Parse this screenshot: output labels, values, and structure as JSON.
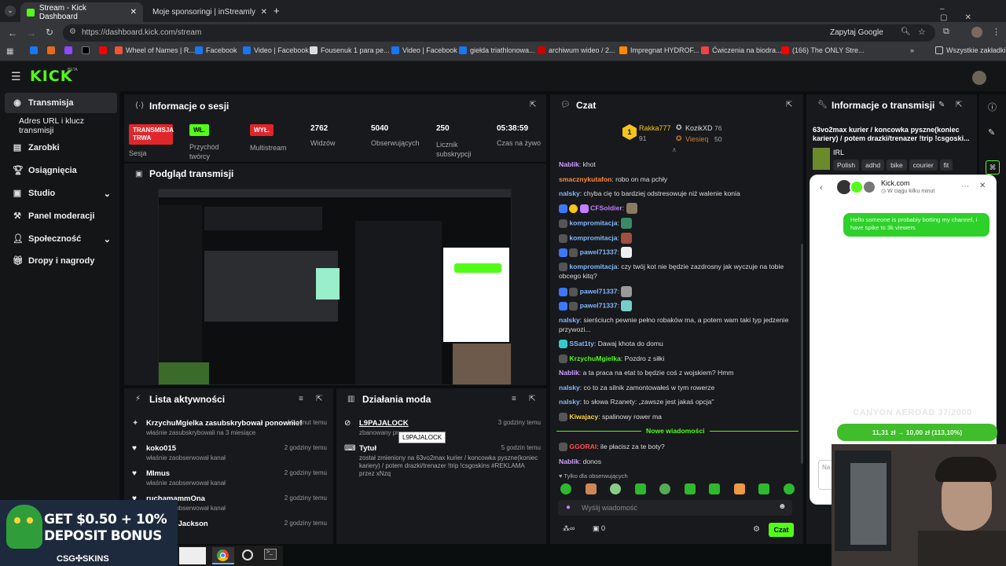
{
  "browser": {
    "tabs": [
      {
        "label": "Stream - Kick Dashboard",
        "active": true
      },
      {
        "label": "Moje sponsoringi | inStreamly",
        "active": false
      }
    ],
    "url": "https://dashboard.kick.com/stream",
    "ask_google": "Zapytaj Google",
    "bookmarks": [
      "Facebook",
      "Wheel of Names | R...",
      "Facebook",
      "Video | Facebook",
      "Fousenuk 1 para pe...",
      "Video | Facebook",
      "giełda triathlonowa...",
      "archiwum wideo / 2...",
      "Impregnat HYDROF...",
      "Ćwiczenia na biodra...",
      "(166) The ONLY Stre..."
    ],
    "all_bookmarks": "Wszystkie zakładki"
  },
  "kick": {
    "logo": "KICK",
    "logo_beta": "BETA"
  },
  "sidebar": {
    "items": [
      {
        "label": "Transmisja",
        "icon": "broadcast-icon"
      },
      {
        "label": "Adres URL i klucz transmisji",
        "icon": ""
      },
      {
        "label": "Zarobki",
        "icon": "earnings-icon"
      },
      {
        "label": "Osiągnięcia",
        "icon": "trophy-icon"
      },
      {
        "label": "Studio",
        "icon": "studio-icon"
      },
      {
        "label": "Panel moderacji",
        "icon": "moderation-icon"
      },
      {
        "label": "Społeczność",
        "icon": "community-icon"
      },
      {
        "label": "Dropy i nagrody",
        "icon": "gift-icon"
      }
    ]
  },
  "session": {
    "title": "Informacje o sesji",
    "badge_live": "TRANSMISJA TRWA",
    "session_label": "Sesja",
    "creator_badge": "WŁ.",
    "creator_label": "Przychód twórcy",
    "multi_badge": "WYŁ.",
    "multi_label": "Multistream",
    "viewers_val": "2762",
    "viewers_label": "Widzów",
    "followers_val": "5040",
    "followers_label": "Obserwujących",
    "subs_val": "250",
    "subs_label": "Licznik subskrypcji",
    "time_val": "05:38:59",
    "time_label": "Czas na żywo"
  },
  "preview": {
    "title": "Podgląd transmisji",
    "promo_line": "CSG SKINS"
  },
  "activity": {
    "title": "Lista aktywności",
    "items": [
      {
        "name": "KrzychuMgielka zasubskrybował ponownie!",
        "sub": "właśnie zasubskrybowali na 3 miesiące",
        "time": "13 minut temu"
      },
      {
        "name": "koko015",
        "sub": "właśnie zaobserwował kanał",
        "time": "2 godziny temu"
      },
      {
        "name": "MImus",
        "sub": "właśnie zaobserwował kanał",
        "time": "2 godziny temu"
      },
      {
        "name": "ruchamammOna",
        "sub": "właśnie zaobserwował kanał",
        "time": "2 godziny temu"
      },
      {
        "name": "gMichaelJackson",
        "sub": "właśnie zaobserwował kanał",
        "time": "2 godziny temu"
      }
    ]
  },
  "modactions": {
    "title": "Działania moda",
    "item1_name": "L9PAJALOCK",
    "item1_sub": "zbanowany pr",
    "item1_time": "3 godziny temu",
    "tooltip": "L9PAJALOCK",
    "item2_name": "Tytuł",
    "item2_sub": "został zmieniony na 63vo2max kurier / koncowka pyszne(koniec kariery) / potem drazki/trenazer !trip !csgoskins #REKLAMA przez xNzq",
    "item2_time": "5 godzin temu"
  },
  "chat": {
    "title": "Czat",
    "top": [
      {
        "name": "Rakka777",
        "val": "91"
      },
      {
        "name": "KozikXD",
        "val": "76"
      },
      {
        "name": "Viesieq",
        "val": "50"
      }
    ],
    "messages": [
      {
        "user": "Nablik",
        "color": "#cfa0ff",
        "text": ": khot"
      },
      {
        "user": "smacznykutafon",
        "color": "#ff8a3d",
        "text": ": robo on ma pchły"
      },
      {
        "user": "nalsky",
        "color": "#7fb8ff",
        "text": ": chyba cię to bardziej odstresowuje niż walenie konia"
      },
      {
        "user": "CFSoldier",
        "color": "#c77dff",
        "text": ":"
      },
      {
        "user": "kompromitacja",
        "color": "#7fb8ff",
        "text": ":"
      },
      {
        "user": "kompromitacja",
        "color": "#7fb8ff",
        "text": ":"
      },
      {
        "user": "pawel71337",
        "color": "#7fb8ff",
        "text": ":"
      },
      {
        "user": "kompromitacja",
        "color": "#7fb8ff",
        "text": ": czy twój kot nie będzie zazdrosny jak wyczuje na tobie obcego kitq?"
      },
      {
        "user": "pawel71337",
        "color": "#7fb8ff",
        "text": ":"
      },
      {
        "user": "pawel71337",
        "color": "#7fb8ff",
        "text": ":"
      },
      {
        "user": "nalsky",
        "color": "#7fb8ff",
        "text": ": sierściuch pewnie pełno robaków ma, a potem wam taki typ jedzenie przywozi..."
      },
      {
        "user": "SSat1ty",
        "color": "#7fb8ff",
        "text": ": Dawaj khota do domu"
      },
      {
        "user": "KrzychuMgielka",
        "color": "#53fc18",
        "text": ": Pozdro z siłki"
      },
      {
        "user": "Nablik",
        "color": "#cfa0ff",
        "text": ": a ta praca na etat to będzie coś z wojskiem? Hmm"
      },
      {
        "user": "nalsky",
        "color": "#7fb8ff",
        "text": ": co to za silnik zamontowałeś w tym rowerze"
      },
      {
        "user": "nalsky",
        "color": "#7fb8ff",
        "text": ": to słowa Rzanety: „zawsze jest jakaś opcja\""
      },
      {
        "user": "Kiwajacy",
        "color": "#ffd43b",
        "text": ": spalinowy rower ma"
      }
    ],
    "new_messages": "Nowe wiadomości",
    "after": [
      {
        "user": "GGORAI",
        "color": "#ff4d4d",
        "text": ": ile płacisz za te boty?"
      },
      {
        "user": "Nablik",
        "color": "#cfa0ff",
        "text": ": donos"
      }
    ],
    "followers_only": "Tylko dla obserwujących",
    "input_placeholder": "Wyślij wiadomość",
    "infinity": "∞",
    "count": "0",
    "send": "Czat"
  },
  "info": {
    "title": "Informacje o transmisji",
    "stream_title": "63vo2max kurier / koncowka pyszne(koniec kariery) / potem drazki/trenazer !trip !csgoski...",
    "category": "IRL",
    "tags": [
      "Polish",
      "adhd",
      "bike",
      "courier",
      "fit"
    ]
  },
  "popup": {
    "name": "Kick.com",
    "status": "W ciągu kilku minut",
    "message": "Hello someone is probably botting my channel, i have spike to 3k viewers",
    "product": "CANYON AEROAD 37/2000",
    "price": "11,31 zł → 10,00 zł (113,10%)",
    "input": "Na"
  },
  "promo": {
    "line1": "GET $0.50 + 10%",
    "line2": "DEPOSIT BONUS",
    "brand": "CSG✣SKINS"
  },
  "colors": {
    "accent": "#53fc18",
    "live": "#e0262b",
    "panel": "#18191c"
  }
}
